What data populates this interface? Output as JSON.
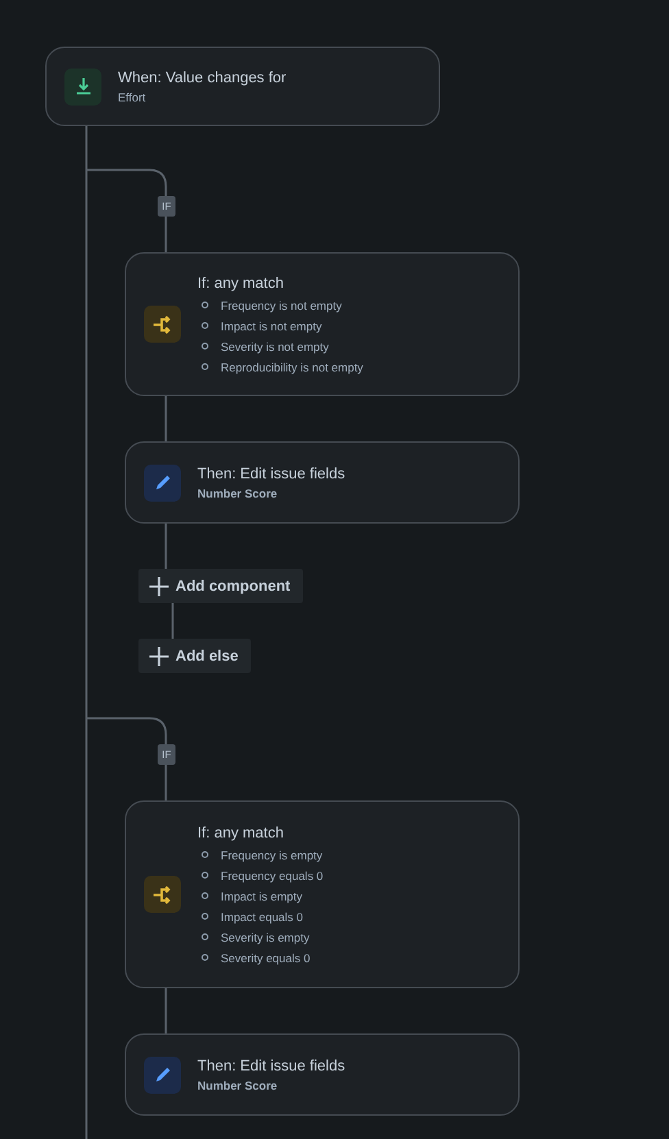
{
  "trigger": {
    "title": "When: Value changes for",
    "subtitle": "Effort"
  },
  "branches": [
    {
      "badge": "IF",
      "condition": {
        "title": "If: any match",
        "items": [
          "Frequency is not empty",
          "Impact is not empty",
          "Severity is not empty",
          "Reproducibility is not empty"
        ]
      },
      "action": {
        "title": "Then: Edit issue fields",
        "subtitle": "Number Score"
      },
      "buttons": [
        "Add component",
        "Add else"
      ]
    },
    {
      "badge": "IF",
      "condition": {
        "title": "If: any match",
        "items": [
          "Frequency is empty",
          "Frequency equals 0",
          "Impact is empty",
          "Impact equals 0",
          "Severity is empty",
          "Severity equals 0"
        ]
      },
      "action": {
        "title": "Then: Edit issue fields",
        "subtitle": "Number Score"
      }
    }
  ]
}
